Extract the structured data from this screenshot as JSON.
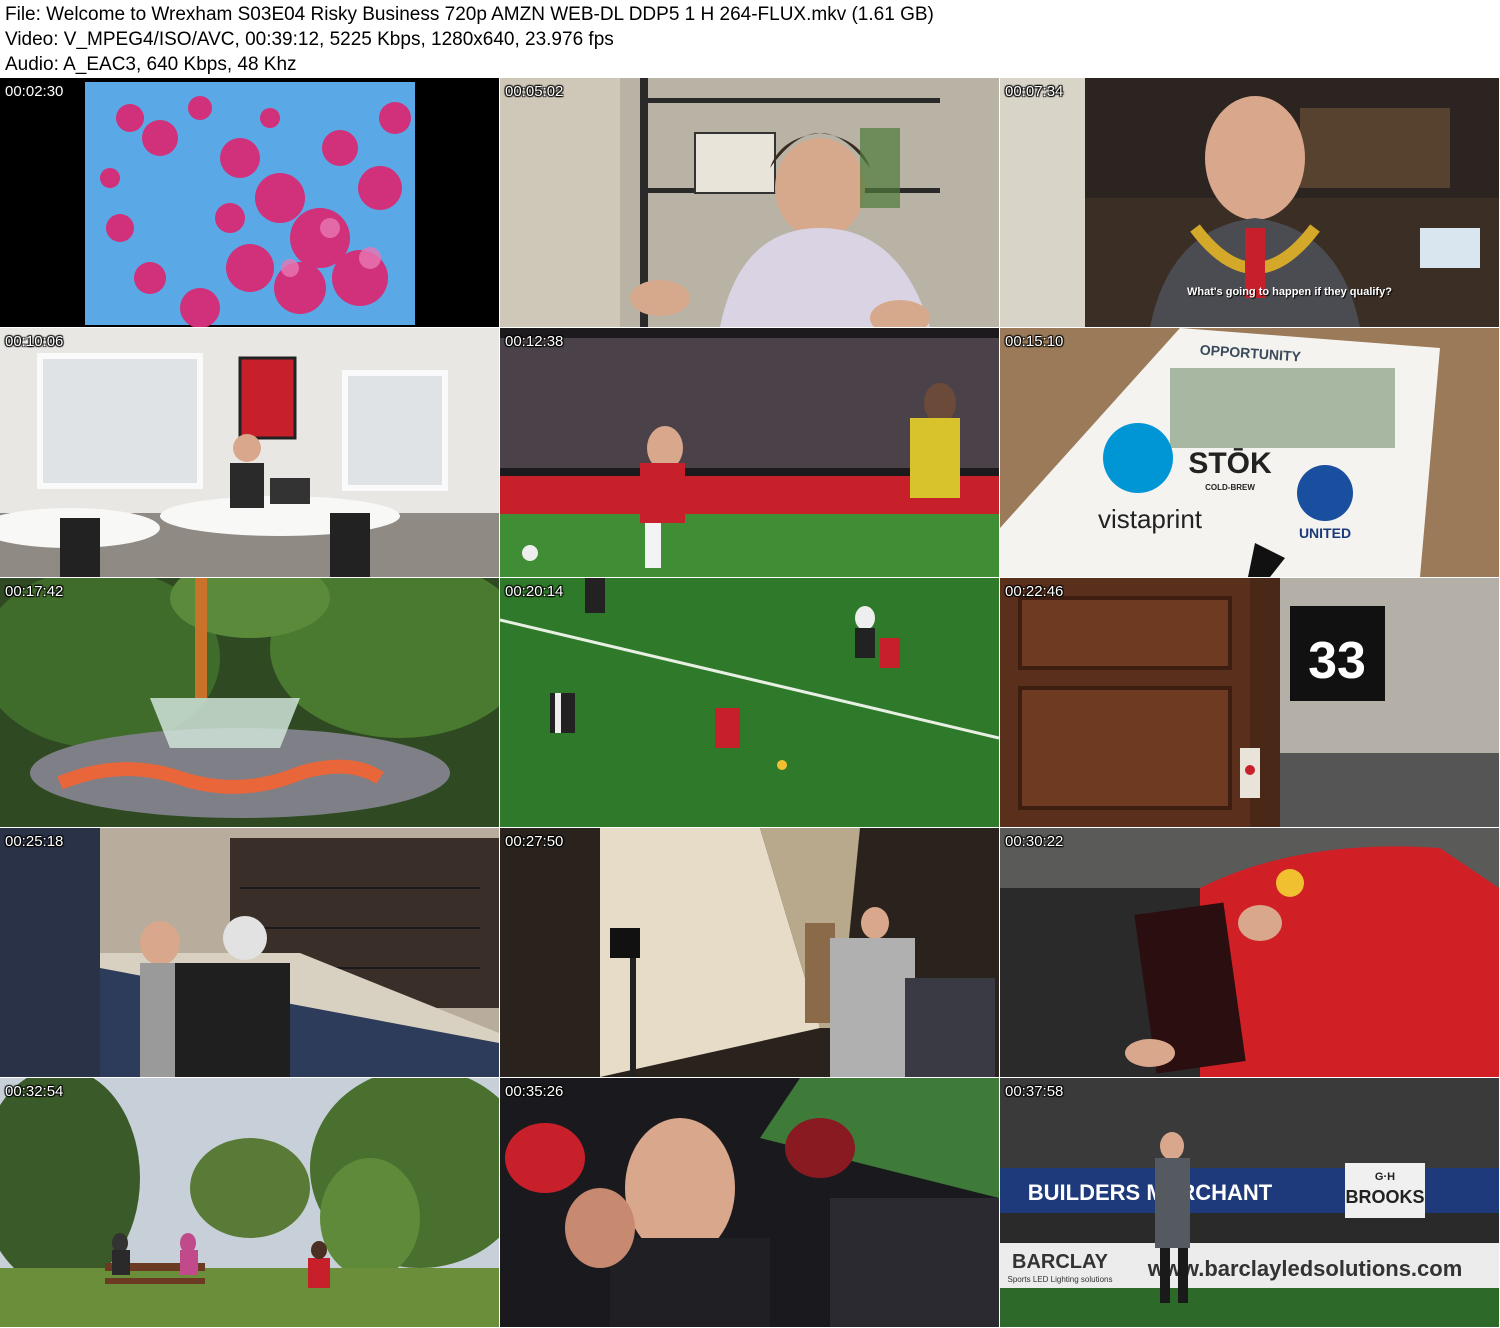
{
  "header": {
    "file_line": "File: Welcome to Wrexham S03E04 Risky Business 720p AMZN WEB-DL DDP5 1 H 264-FLUX.mkv (1.61 GB)",
    "video_line": "Video: V_MPEG4/ISO/AVC, 00:39:12, 5225 Kbps, 1280x640, 23.976 fps",
    "audio_line": "Audio: A_EAC3, 640 Kbps, 48 Khz"
  },
  "thumbnails": [
    {
      "timestamp": "00:02:30"
    },
    {
      "timestamp": "00:05:02"
    },
    {
      "timestamp": "00:07:34",
      "subtitle": "What's going to happen if they qualify?"
    },
    {
      "timestamp": "00:10:06"
    },
    {
      "timestamp": "00:12:38"
    },
    {
      "timestamp": "00:15:10",
      "sign_texts": [
        "OPPORTUNITY",
        "STŌK",
        "COLD-BREW",
        "UNITED",
        "vistaprint"
      ]
    },
    {
      "timestamp": "00:17:42"
    },
    {
      "timestamp": "00:20:14"
    },
    {
      "timestamp": "00:22:46",
      "sign_texts": [
        "33"
      ]
    },
    {
      "timestamp": "00:25:18"
    },
    {
      "timestamp": "00:27:50"
    },
    {
      "timestamp": "00:30:22"
    },
    {
      "timestamp": "00:32:54"
    },
    {
      "timestamp": "00:35:26"
    },
    {
      "timestamp": "00:37:58",
      "sign_texts": [
        "BUILDERS MERCHANT",
        "G·H",
        "BROOKS",
        "BARCLAY",
        "Sports LED Lighting solutions",
        "www.barclayledsolutions.com"
      ]
    }
  ],
  "colors": {
    "pitch_green": "#2f7a2a",
    "wrexham_red": "#c8202a",
    "background": "#ffffff"
  }
}
